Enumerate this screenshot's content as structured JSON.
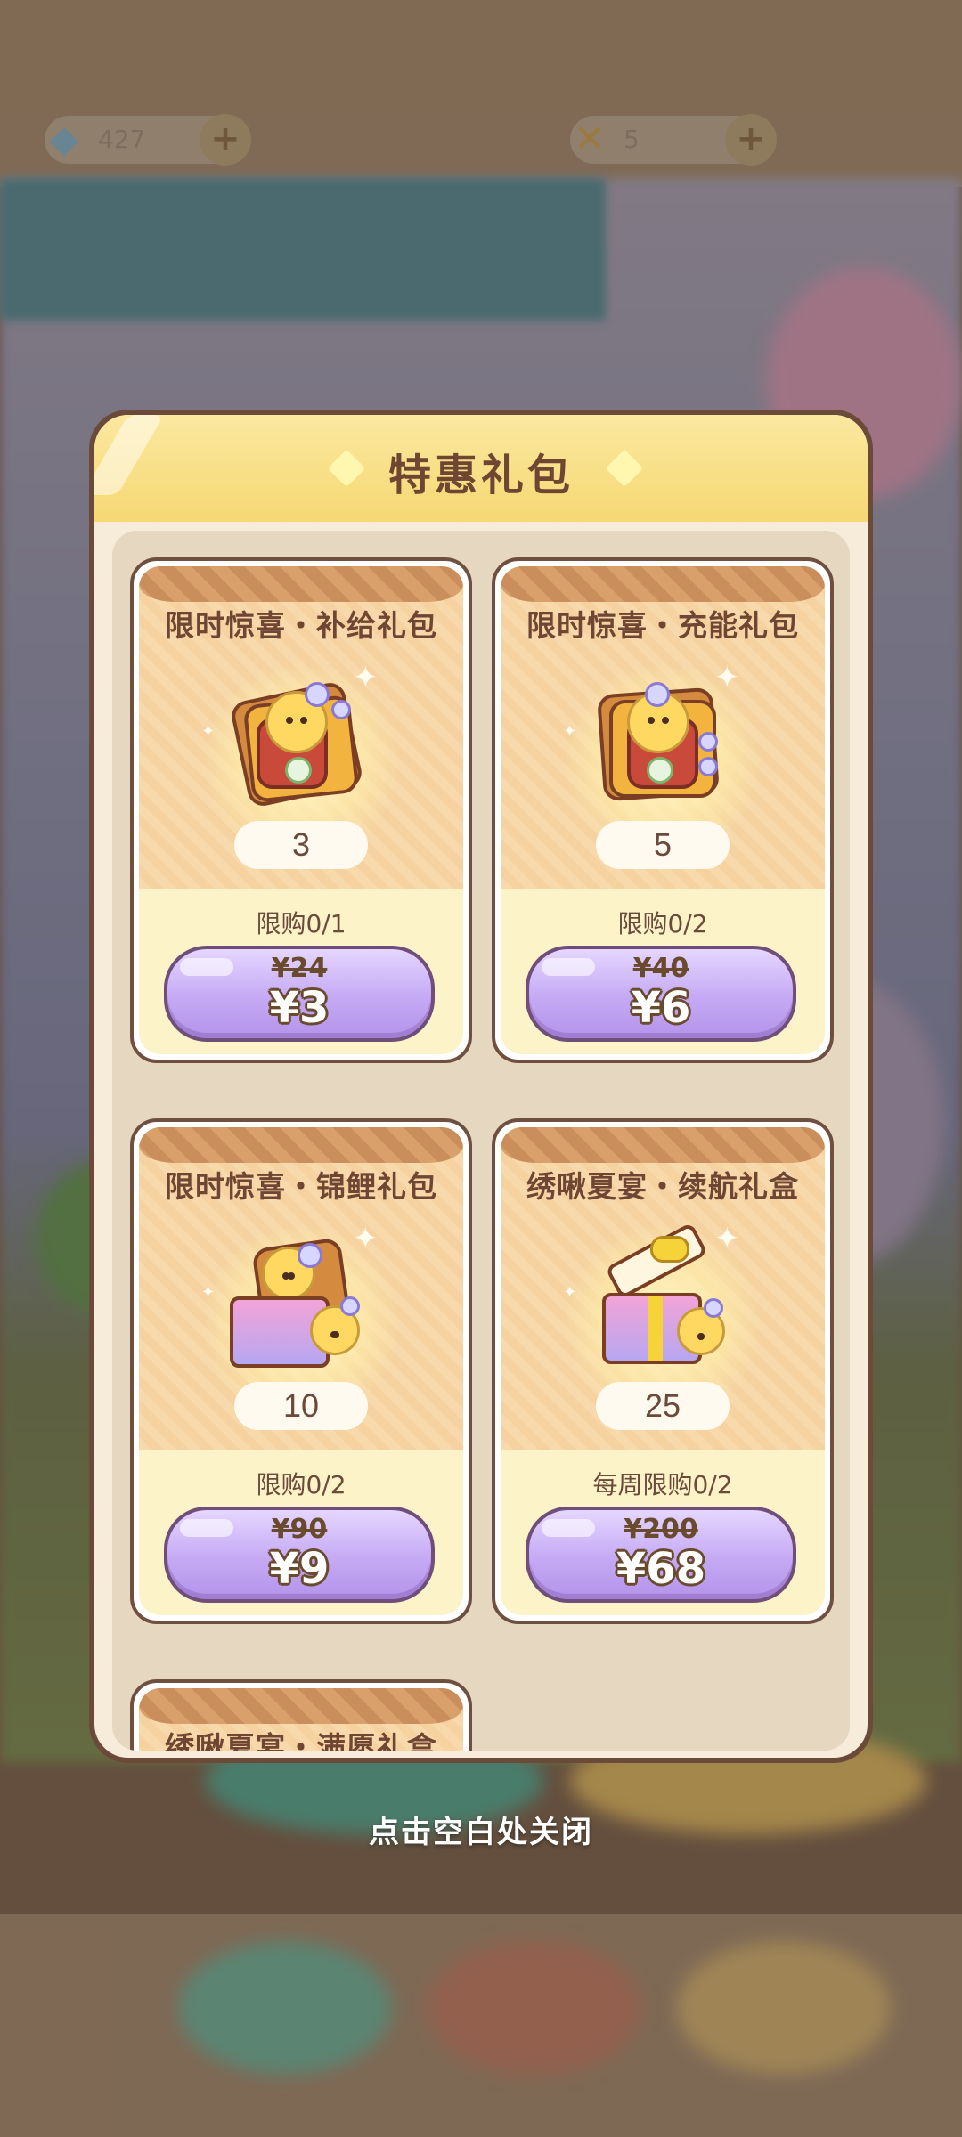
{
  "currency": [
    {
      "icon": "diamond-icon",
      "value": "427"
    },
    {
      "icon": "ticket-icon",
      "value": "5"
    }
  ],
  "modal": {
    "title": "特惠礼包"
  },
  "packages": [
    {
      "title": "限时惊喜・补给礼包",
      "quantity": "3",
      "limit": "限购0/1",
      "old_price": "¥24",
      "price": "¥3"
    },
    {
      "title": "限时惊喜・充能礼包",
      "quantity": "5",
      "limit": "限购0/2",
      "old_price": "¥40",
      "price": "¥6"
    },
    {
      "title": "限时惊喜・锦鲤礼包",
      "quantity": "10",
      "limit": "限购0/2",
      "old_price": "¥90",
      "price": "¥9"
    },
    {
      "title": "绣啾夏宴・续航礼盒",
      "quantity": "25",
      "limit": "每周限购0/2",
      "old_price": "¥200",
      "price": "¥68"
    },
    {
      "title": "绣啾夏宴・满愿礼盒"
    }
  ],
  "close_hint": "点击空白处关闭"
}
